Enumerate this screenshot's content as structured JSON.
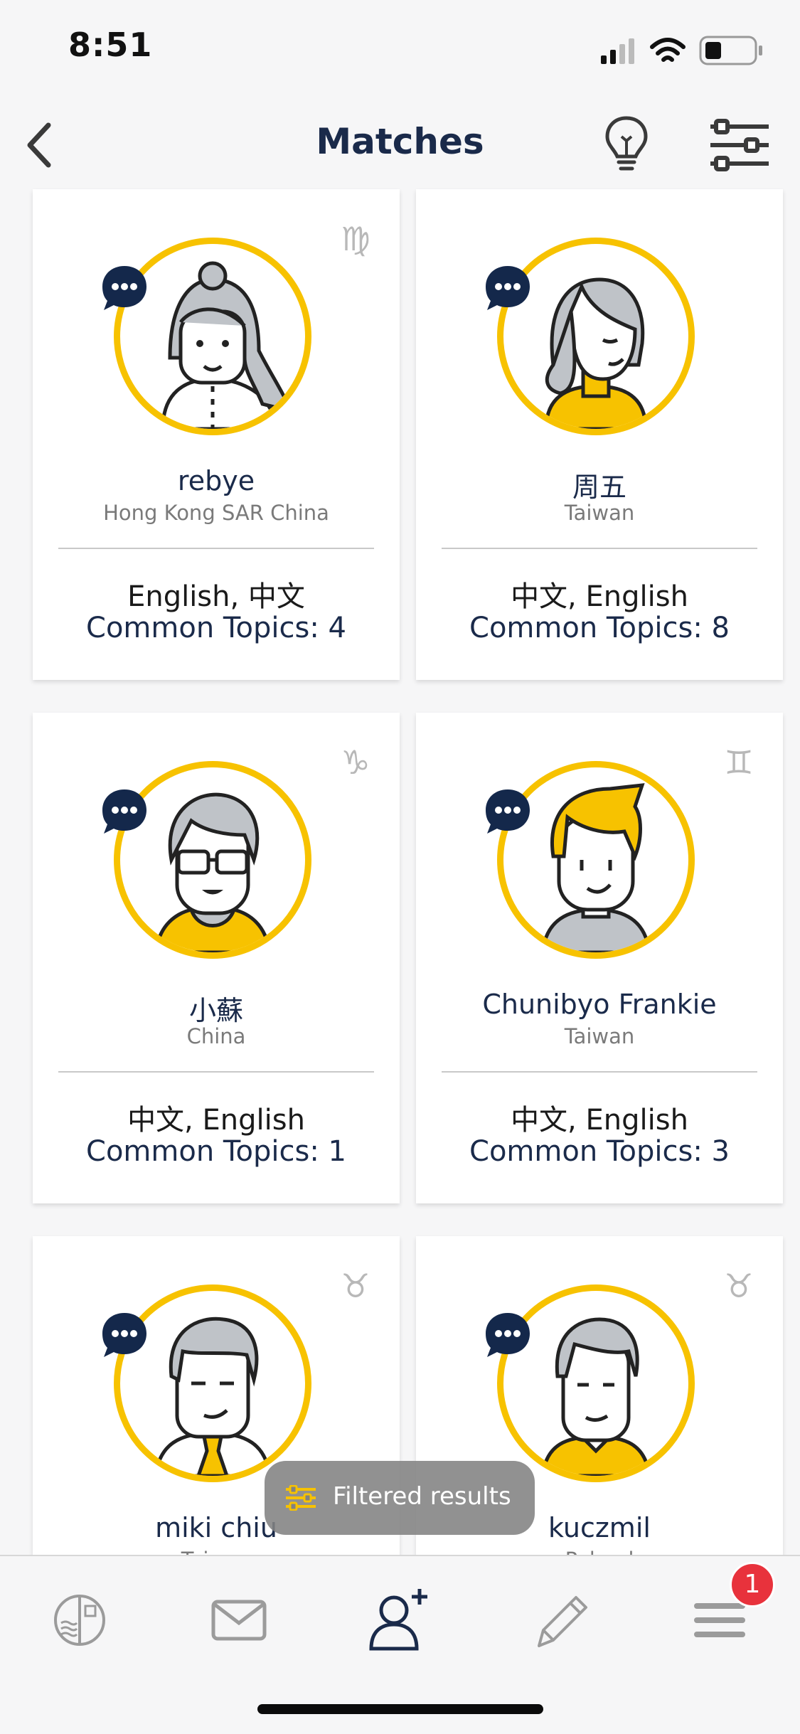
{
  "status": {
    "time": "8:51"
  },
  "header": {
    "title": "Matches"
  },
  "matches": [
    {
      "name": "rebye",
      "country": "Hong Kong SAR China",
      "languages": "English, 中文",
      "topics": "Common Topics: 4",
      "zodiac": "virgo-icon",
      "zodiac_glyph": "♍"
    },
    {
      "name": "周五",
      "country": "Taiwan",
      "languages": "中文, English",
      "topics": "Common Topics: 8",
      "zodiac": "none",
      "zodiac_glyph": ""
    },
    {
      "name": "小蘇",
      "country": "China",
      "languages": "中文, English",
      "topics": "Common Topics: 1",
      "zodiac": "capricorn-icon",
      "zodiac_glyph": "♑"
    },
    {
      "name": "Chunibyo Frankie",
      "country": "Taiwan",
      "languages": "中文, English",
      "topics": "Common Topics: 3",
      "zodiac": "gemini-icon",
      "zodiac_glyph": "♊"
    },
    {
      "name": "miki chiu",
      "country": "Taiwan",
      "languages": "",
      "topics": "",
      "zodiac": "taurus-icon",
      "zodiac_glyph": "♉"
    },
    {
      "name": "kuczmil",
      "country": "Poland",
      "languages": "",
      "topics": "",
      "zodiac": "taurus-icon",
      "zodiac_glyph": "♉"
    }
  ],
  "toast": {
    "text": "Filtered results"
  },
  "tabbar": {
    "items": [
      "journal-icon",
      "mail-icon",
      "add-friend-icon",
      "pencil-icon",
      "menu-icon"
    ],
    "active_index": 2,
    "menu_badge": "1"
  },
  "colors": {
    "accent": "#f7c200",
    "navy": "#1a2a4a",
    "badge": "#e8323c"
  }
}
